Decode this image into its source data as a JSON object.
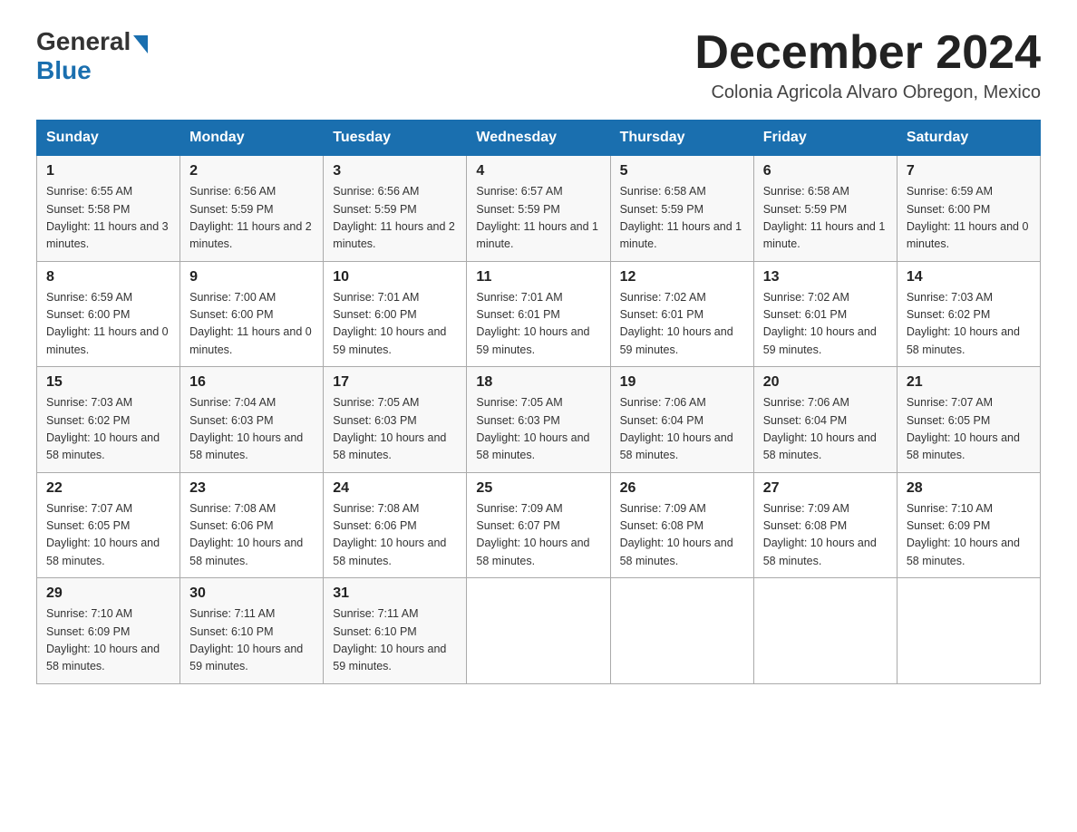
{
  "header": {
    "logo_general": "General",
    "logo_blue": "Blue",
    "month_title": "December 2024",
    "subtitle": "Colonia Agricola Alvaro Obregon, Mexico"
  },
  "days_of_week": [
    "Sunday",
    "Monday",
    "Tuesday",
    "Wednesday",
    "Thursday",
    "Friday",
    "Saturday"
  ],
  "weeks": [
    [
      {
        "num": "1",
        "sunrise": "6:55 AM",
        "sunset": "5:58 PM",
        "daylight": "11 hours and 3 minutes."
      },
      {
        "num": "2",
        "sunrise": "6:56 AM",
        "sunset": "5:59 PM",
        "daylight": "11 hours and 2 minutes."
      },
      {
        "num": "3",
        "sunrise": "6:56 AM",
        "sunset": "5:59 PM",
        "daylight": "11 hours and 2 minutes."
      },
      {
        "num": "4",
        "sunrise": "6:57 AM",
        "sunset": "5:59 PM",
        "daylight": "11 hours and 1 minute."
      },
      {
        "num": "5",
        "sunrise": "6:58 AM",
        "sunset": "5:59 PM",
        "daylight": "11 hours and 1 minute."
      },
      {
        "num": "6",
        "sunrise": "6:58 AM",
        "sunset": "5:59 PM",
        "daylight": "11 hours and 1 minute."
      },
      {
        "num": "7",
        "sunrise": "6:59 AM",
        "sunset": "6:00 PM",
        "daylight": "11 hours and 0 minutes."
      }
    ],
    [
      {
        "num": "8",
        "sunrise": "6:59 AM",
        "sunset": "6:00 PM",
        "daylight": "11 hours and 0 minutes."
      },
      {
        "num": "9",
        "sunrise": "7:00 AM",
        "sunset": "6:00 PM",
        "daylight": "11 hours and 0 minutes."
      },
      {
        "num": "10",
        "sunrise": "7:01 AM",
        "sunset": "6:00 PM",
        "daylight": "10 hours and 59 minutes."
      },
      {
        "num": "11",
        "sunrise": "7:01 AM",
        "sunset": "6:01 PM",
        "daylight": "10 hours and 59 minutes."
      },
      {
        "num": "12",
        "sunrise": "7:02 AM",
        "sunset": "6:01 PM",
        "daylight": "10 hours and 59 minutes."
      },
      {
        "num": "13",
        "sunrise": "7:02 AM",
        "sunset": "6:01 PM",
        "daylight": "10 hours and 59 minutes."
      },
      {
        "num": "14",
        "sunrise": "7:03 AM",
        "sunset": "6:02 PM",
        "daylight": "10 hours and 58 minutes."
      }
    ],
    [
      {
        "num": "15",
        "sunrise": "7:03 AM",
        "sunset": "6:02 PM",
        "daylight": "10 hours and 58 minutes."
      },
      {
        "num": "16",
        "sunrise": "7:04 AM",
        "sunset": "6:03 PM",
        "daylight": "10 hours and 58 minutes."
      },
      {
        "num": "17",
        "sunrise": "7:05 AM",
        "sunset": "6:03 PM",
        "daylight": "10 hours and 58 minutes."
      },
      {
        "num": "18",
        "sunrise": "7:05 AM",
        "sunset": "6:03 PM",
        "daylight": "10 hours and 58 minutes."
      },
      {
        "num": "19",
        "sunrise": "7:06 AM",
        "sunset": "6:04 PM",
        "daylight": "10 hours and 58 minutes."
      },
      {
        "num": "20",
        "sunrise": "7:06 AM",
        "sunset": "6:04 PM",
        "daylight": "10 hours and 58 minutes."
      },
      {
        "num": "21",
        "sunrise": "7:07 AM",
        "sunset": "6:05 PM",
        "daylight": "10 hours and 58 minutes."
      }
    ],
    [
      {
        "num": "22",
        "sunrise": "7:07 AM",
        "sunset": "6:05 PM",
        "daylight": "10 hours and 58 minutes."
      },
      {
        "num": "23",
        "sunrise": "7:08 AM",
        "sunset": "6:06 PM",
        "daylight": "10 hours and 58 minutes."
      },
      {
        "num": "24",
        "sunrise": "7:08 AM",
        "sunset": "6:06 PM",
        "daylight": "10 hours and 58 minutes."
      },
      {
        "num": "25",
        "sunrise": "7:09 AM",
        "sunset": "6:07 PM",
        "daylight": "10 hours and 58 minutes."
      },
      {
        "num": "26",
        "sunrise": "7:09 AM",
        "sunset": "6:08 PM",
        "daylight": "10 hours and 58 minutes."
      },
      {
        "num": "27",
        "sunrise": "7:09 AM",
        "sunset": "6:08 PM",
        "daylight": "10 hours and 58 minutes."
      },
      {
        "num": "28",
        "sunrise": "7:10 AM",
        "sunset": "6:09 PM",
        "daylight": "10 hours and 58 minutes."
      }
    ],
    [
      {
        "num": "29",
        "sunrise": "7:10 AM",
        "sunset": "6:09 PM",
        "daylight": "10 hours and 58 minutes."
      },
      {
        "num": "30",
        "sunrise": "7:11 AM",
        "sunset": "6:10 PM",
        "daylight": "10 hours and 59 minutes."
      },
      {
        "num": "31",
        "sunrise": "7:11 AM",
        "sunset": "6:10 PM",
        "daylight": "10 hours and 59 minutes."
      },
      null,
      null,
      null,
      null
    ]
  ],
  "labels": {
    "sunrise": "Sunrise:",
    "sunset": "Sunset:",
    "daylight": "Daylight:"
  }
}
